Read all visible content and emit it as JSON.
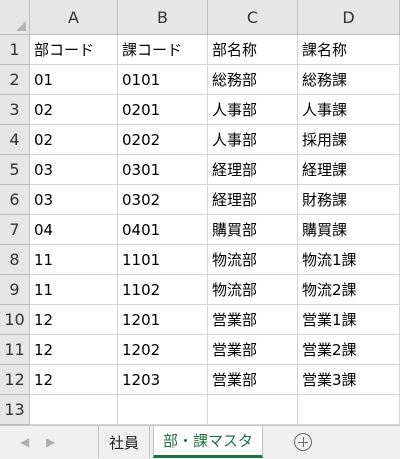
{
  "sheet": {
    "columns": [
      "A",
      "B",
      "C",
      "D"
    ],
    "rows": [
      {
        "num": "1",
        "cells": [
          "部コード",
          "課コード",
          "部名称",
          "課名称"
        ]
      },
      {
        "num": "2",
        "cells": [
          "01",
          "0101",
          "総務部",
          "総務課"
        ]
      },
      {
        "num": "3",
        "cells": [
          "02",
          "0201",
          "人事部",
          "人事課"
        ]
      },
      {
        "num": "4",
        "cells": [
          "02",
          "0202",
          "人事部",
          "採用課"
        ]
      },
      {
        "num": "5",
        "cells": [
          "03",
          "0301",
          "経理部",
          "経理課"
        ]
      },
      {
        "num": "6",
        "cells": [
          "03",
          "0302",
          "経理部",
          "財務課"
        ]
      },
      {
        "num": "7",
        "cells": [
          "04",
          "0401",
          "購買部",
          "購買課"
        ]
      },
      {
        "num": "8",
        "cells": [
          "11",
          "1101",
          "物流部",
          "物流1課"
        ]
      },
      {
        "num": "9",
        "cells": [
          "11",
          "1102",
          "物流部",
          "物流2課"
        ]
      },
      {
        "num": "10",
        "cells": [
          "12",
          "1201",
          "営業部",
          "営業1課"
        ]
      },
      {
        "num": "11",
        "cells": [
          "12",
          "1202",
          "営業部",
          "営業2課"
        ]
      },
      {
        "num": "12",
        "cells": [
          "12",
          "1203",
          "営業部",
          "営業3課"
        ]
      },
      {
        "num": "13",
        "cells": [
          "",
          "",
          "",
          ""
        ]
      }
    ]
  },
  "tabs": {
    "prev_icon": "◀",
    "next_icon": "▶",
    "items": [
      {
        "label": "社員",
        "active": false
      },
      {
        "label": "部・課マスタ",
        "active": true
      }
    ],
    "accent_color": "#1e7145"
  }
}
